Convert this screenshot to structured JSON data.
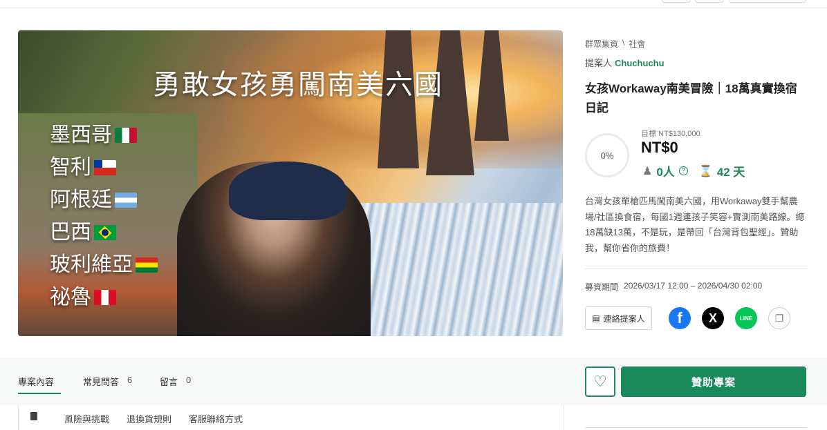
{
  "hero": {
    "title": "勇敢女孩勇闖南美六國",
    "countries": [
      {
        "name": "墨西哥",
        "flag": "mexico-flag-icon"
      },
      {
        "name": "智利",
        "flag": "chile-flag-icon"
      },
      {
        "name": "阿根廷",
        "flag": "argentina-flag-icon"
      },
      {
        "name": "巴西",
        "flag": "brazil-flag-icon"
      },
      {
        "name": "玻利維亞",
        "flag": "bolivia-flag-icon"
      },
      {
        "name": "祕魯",
        "flag": "peru-flag-icon"
      }
    ]
  },
  "breadcrumb": {
    "section": "群眾集資",
    "separator": "\\",
    "category": "社會"
  },
  "proposer": {
    "label": "提案人",
    "name": "Chuchuchu"
  },
  "project": {
    "title": "女孩Workaway南美冒險｜18萬真實換宿日記",
    "progress": "0%",
    "goal": "目標 NT$130,000",
    "amount": "NT$0",
    "backers": "0人",
    "days": "42 天",
    "description": "台灣女孩單槍匹馬闖南美六國，用Workaway雙手幫農場/社區換食宿，每國1週連孩子笑容+實測南美路線。總18萬缺13萬，不是玩，是帶回「台灣背包聖經」。贊助我，幫你省你的旅費！",
    "period_label": "募資期間",
    "period": "2026/03/17 12:00 – 2026/04/30 02:00"
  },
  "actions": {
    "contact": "連絡提案人"
  },
  "tabs": [
    {
      "label": "專案內容",
      "count": ""
    },
    {
      "label": "常見問答",
      "count": "6"
    },
    {
      "label": "留言",
      "count": "0"
    }
  ],
  "sponsor_button": "贊助專案",
  "subnav": [
    "風險與挑戰",
    "退換貨規則",
    "客服聯絡方式"
  ],
  "colors": {
    "accent": "#1b8a5a",
    "facebook": "#1877f2",
    "line": "#06c755"
  }
}
